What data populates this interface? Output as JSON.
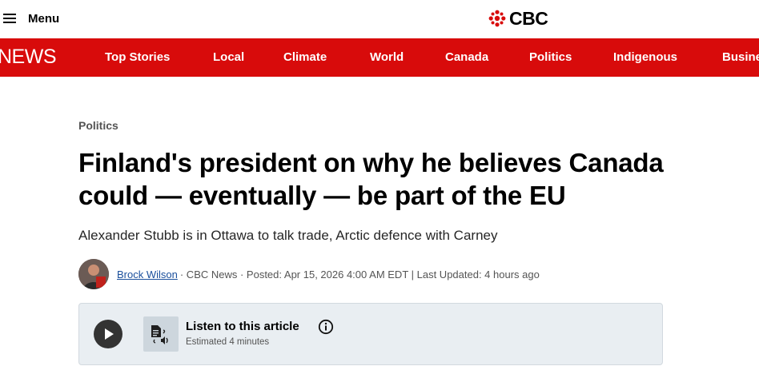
{
  "header": {
    "menu_label": "Menu",
    "logo_text": "CBC"
  },
  "nav": {
    "brand": "NEWS",
    "items": [
      "Top Stories",
      "Local",
      "Climate",
      "World",
      "Canada",
      "Politics",
      "Indigenous",
      "Business"
    ],
    "color": "#d80b0b"
  },
  "article": {
    "section": "Politics",
    "headline": "Finland's president on why he believes Canada could — eventually — be part of the EU",
    "subheadline": "Alexander Stubb is in Ottawa to talk trade, Arctic defence with Carney",
    "byline": {
      "author": "Brock Wilson",
      "meta": "· CBC News · Posted: Apr 15, 2026 4:00 AM EDT | Last Updated: 4 hours ago"
    }
  },
  "listen": {
    "title": "Listen to this article",
    "estimate": "Estimated 4 minutes",
    "icons": [
      "play-icon",
      "text-to-audio-icon",
      "info-icon"
    ]
  }
}
